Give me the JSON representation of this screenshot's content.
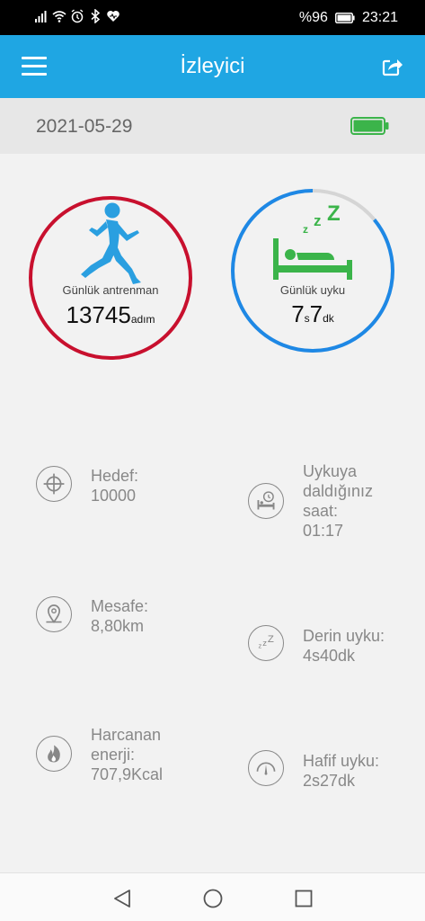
{
  "status_bar": {
    "battery_percent": "%96",
    "time": "23:21"
  },
  "app_bar": {
    "title": "İzleyici",
    "menu_icon": "hamburger-menu-icon",
    "share_icon": "share-icon"
  },
  "date_bar": {
    "date": "2021-05-29",
    "battery_icon": "battery-full-icon"
  },
  "activity_ring": {
    "label": "Günlük antrenman",
    "value": "13745",
    "unit": "adım",
    "color": "#c8102e"
  },
  "sleep_ring": {
    "label": "Günlük uyku",
    "hours": "7",
    "hours_unit": "s",
    "minutes": "7",
    "minutes_unit": "dk",
    "color": "#1e88e5",
    "track_color": "#d5d5d5",
    "icon_color": "#3bb44a",
    "progress_fraction": 0.86
  },
  "stats": {
    "goal": {
      "lines": [
        "Hedef:",
        "10000"
      ],
      "icon": "target-icon"
    },
    "distance": {
      "lines": [
        "Mesafe:",
        "8,80km"
      ],
      "icon": "location-pin-icon"
    },
    "energy": {
      "lines": [
        "Harcanan",
        "enerji:",
        "707,9Kcal"
      ],
      "icon": "flame-icon"
    },
    "fell_asleep": {
      "lines": [
        "Uykuya",
        "daldığınız",
        "saat:",
        "01:17"
      ],
      "icon": "bed-clock-icon"
    },
    "deep_sleep": {
      "lines": [
        "Derin uyku:",
        "4s40dk"
      ],
      "icon": "zzz-icon"
    },
    "light_sleep": {
      "lines": [
        "Hafif uyku:",
        "2s27dk"
      ],
      "icon": "gauge-icon"
    }
  },
  "nav_bar": {
    "back_icon": "back-triangle-icon",
    "home_icon": "home-circle-icon",
    "recents_icon": "recents-square-icon"
  }
}
